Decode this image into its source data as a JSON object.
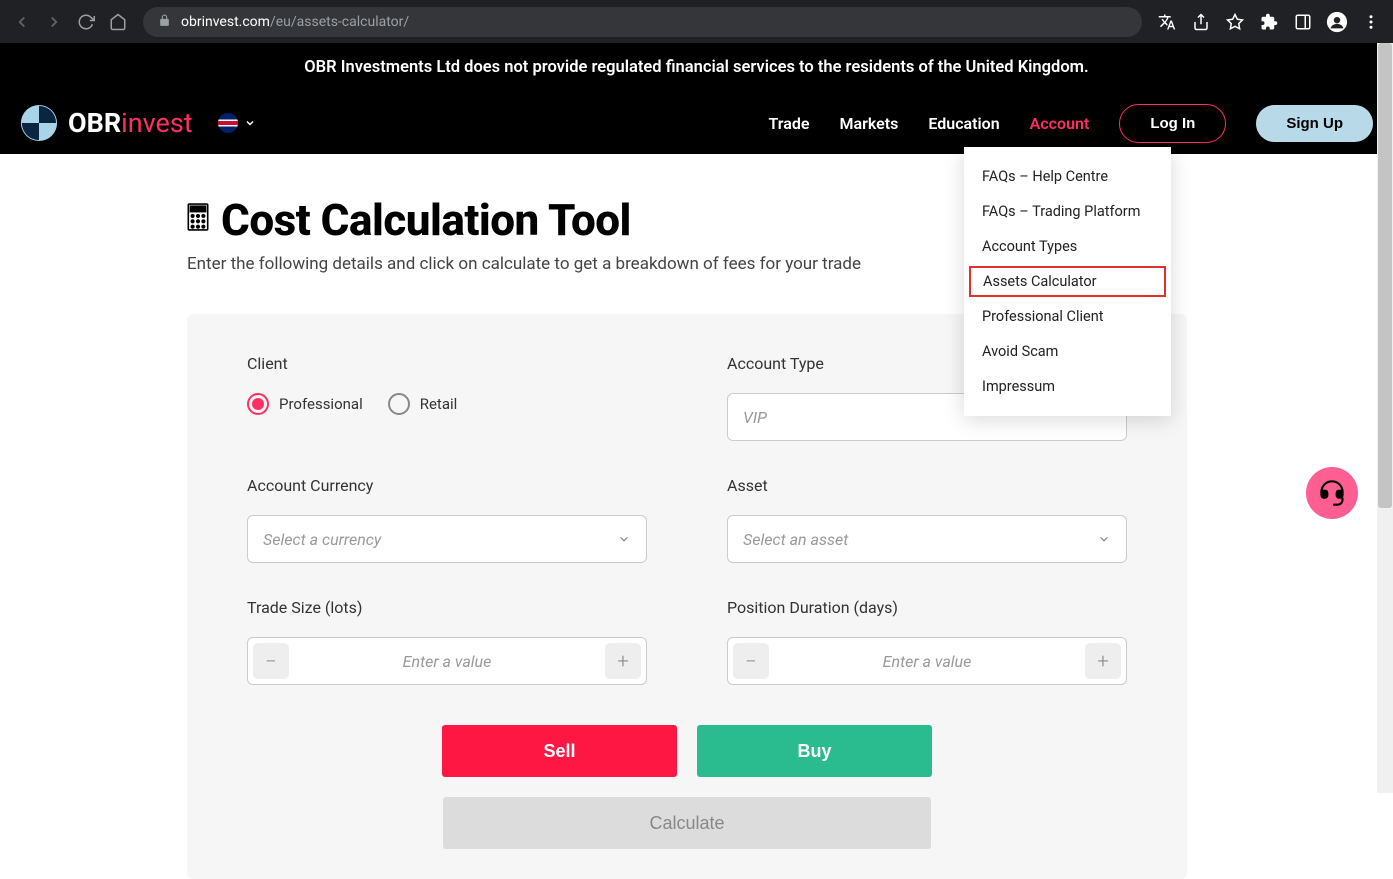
{
  "browser": {
    "url_prefix": "obrinvest.com",
    "url_path": "/eu/assets-calculator/"
  },
  "banner": "OBR Investments Ltd does not provide regulated financial services to the residents of the United Kingdom.",
  "logo": {
    "part1": "OBR",
    "part2": "invest"
  },
  "nav": {
    "trade": "Trade",
    "markets": "Markets",
    "education": "Education",
    "account": "Account",
    "login": "Log In",
    "signup": "Sign Up"
  },
  "dropdown": {
    "items": [
      "FAQs – Help Centre",
      "FAQs – Trading Platform",
      "Account Types",
      "Assets Calculator",
      "Professional Client",
      "Avoid Scam",
      "Impressum"
    ]
  },
  "page": {
    "title": "Cost Calculation Tool",
    "subtitle": "Enter the following details and click on calculate to get a breakdown of fees for your trade"
  },
  "form": {
    "client_label": "Client",
    "client_professional": "Professional",
    "client_retail": "Retail",
    "account_type_label": "Account Type",
    "account_type_placeholder": "VIP",
    "currency_label": "Account Currency",
    "currency_placeholder": "Select a currency",
    "asset_label": "Asset",
    "asset_placeholder": "Select an asset",
    "trade_size_label": "Trade Size (lots)",
    "trade_size_placeholder": "Enter a value",
    "position_duration_label": "Position Duration (days)",
    "position_duration_placeholder": "Enter a value",
    "sell": "Sell",
    "buy": "Buy",
    "calculate": "Calculate"
  }
}
